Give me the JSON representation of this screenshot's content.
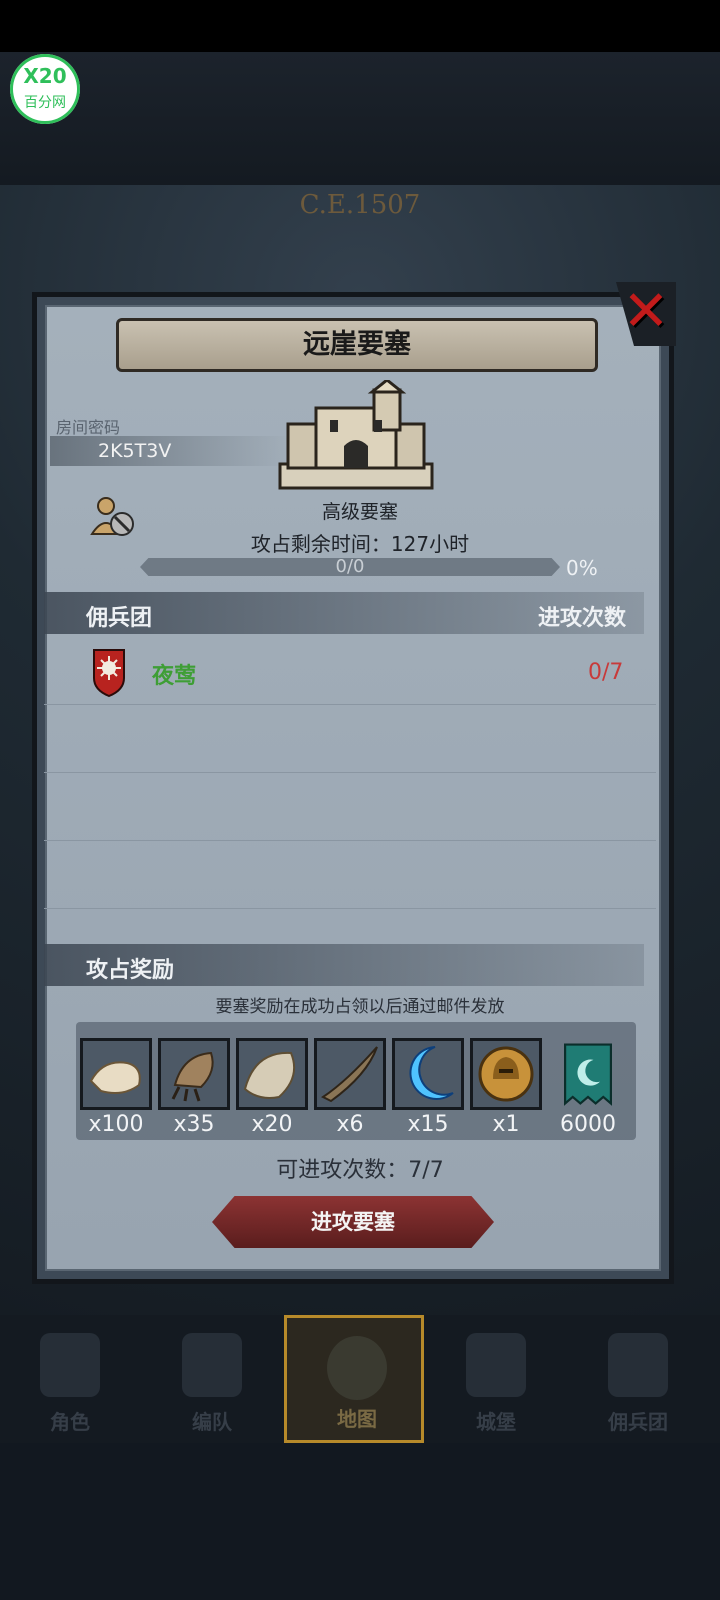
{
  "app": {
    "logo_top": "X20",
    "logo_bottom": "百分网"
  },
  "scene": {
    "era": "C.E.1507"
  },
  "panel": {
    "title": "远崖要塞",
    "room_code_label": "房间密码",
    "room_code_value": "2K5T3V",
    "fortress_type": "高级要塞",
    "time_label": "攻占剩余时间：",
    "time_value": "127",
    "time_unit": "小时",
    "progress_text": "0/0",
    "progress_percent": "0%",
    "progress_fraction": 0,
    "mercenary_header": "佣兵团",
    "attacks_header": "进攻次数",
    "mercenaries": [
      {
        "name": "夜莺",
        "count": "0/7"
      }
    ],
    "reward_header": "攻占奖励",
    "reward_note": "要塞奖励在成功占领以后通过邮件发放",
    "rewards": [
      {
        "icon": "pelt-icon",
        "qty": "x100"
      },
      {
        "icon": "claw-icon",
        "qty": "x35"
      },
      {
        "icon": "hide-icon",
        "qty": "x20"
      },
      {
        "icon": "horn-icon",
        "qty": "x6"
      },
      {
        "icon": "crescent-gem-icon",
        "qty": "x15"
      },
      {
        "icon": "helmet-coin-icon",
        "qty": "x1"
      },
      {
        "icon": "banner-icon",
        "qty": "6000"
      }
    ],
    "attack_count_label": "可进攻次数：",
    "attack_count_value": "7/7",
    "attack_button": "进攻要塞"
  },
  "nav": [
    {
      "label": "角色",
      "icon": "knight-icon"
    },
    {
      "label": "编队",
      "icon": "formation-icon"
    },
    {
      "label": "地图",
      "icon": "map-icon"
    },
    {
      "label": "城堡",
      "icon": "castle-icon"
    },
    {
      "label": "佣兵团",
      "icon": "mercenary-icon"
    }
  ],
  "colors": {
    "accent": "#b78a2a",
    "green": "#3e9e35",
    "red": "#c83a3a"
  }
}
